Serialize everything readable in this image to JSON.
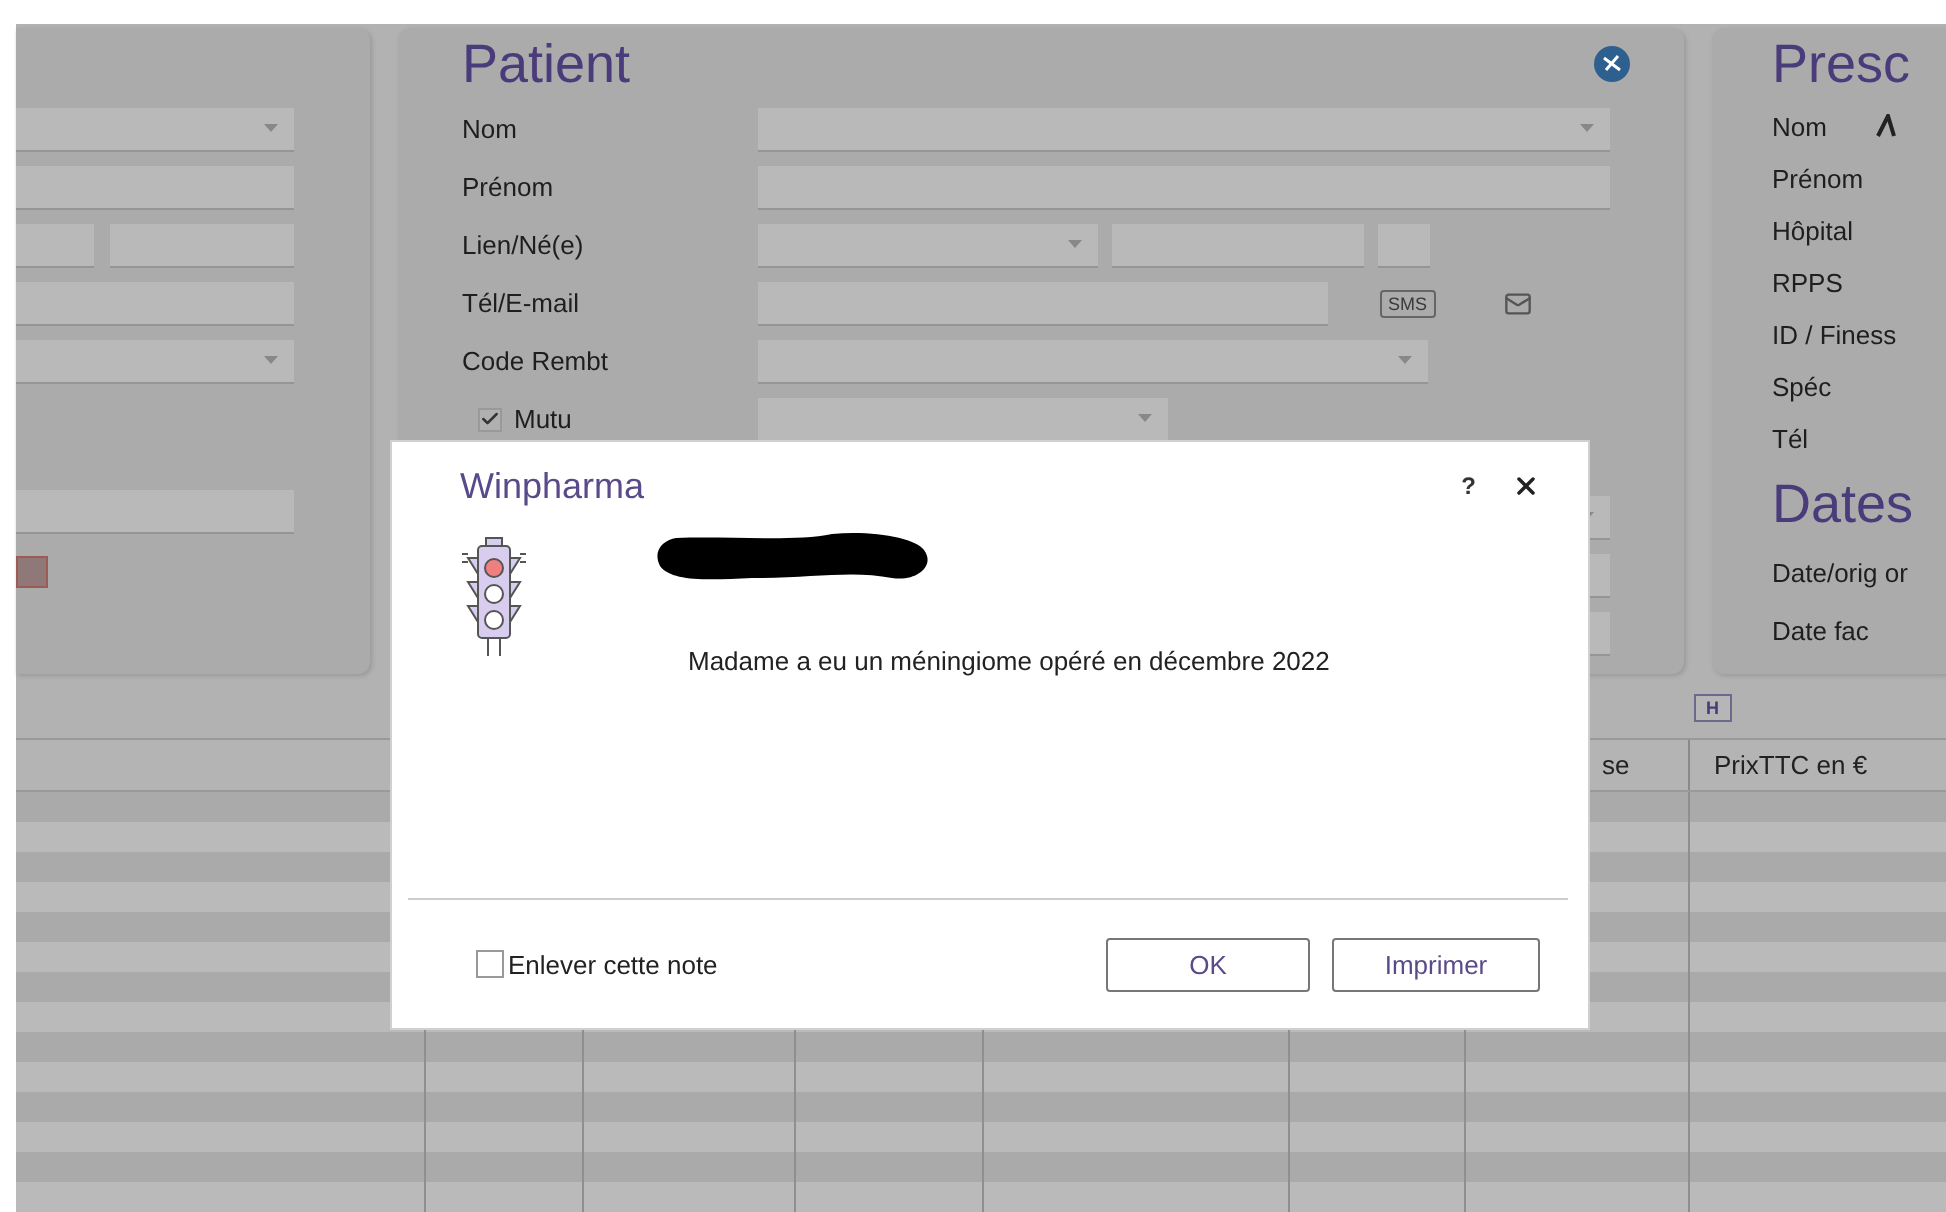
{
  "patient_panel": {
    "title": "Patient",
    "rows": [
      {
        "label": "Nom"
      },
      {
        "label": "Prénom"
      },
      {
        "label": "Lien/Né(e)"
      },
      {
        "label": "Tél/E-mail",
        "sms": "SMS"
      },
      {
        "label": "Code Rembt"
      },
      {
        "label": "Mutu",
        "checked": true
      }
    ]
  },
  "prescriber_panel": {
    "title": "Presc",
    "labels": [
      "Nom",
      "Prénom",
      "Hôpital",
      "RPPS",
      "ID / Finess",
      "Spéc",
      "Tél"
    ],
    "dates_title": "Dates",
    "date_labels": [
      "Date/orig or",
      "Date fac"
    ]
  },
  "toolbar": {
    "button": "H"
  },
  "table": {
    "columns": [
      {
        "label": "se"
      },
      {
        "label": "PrixTTC en €"
      }
    ]
  },
  "dialog": {
    "title": "Winpharma",
    "help": "?",
    "message": "Madame a eu un méningiome opéré en décembre 2022",
    "remove_note": {
      "label": "Enlever cette note",
      "checked": false
    },
    "buttons": [
      {
        "label": "OK"
      },
      {
        "label": "Imprimer"
      }
    ]
  }
}
